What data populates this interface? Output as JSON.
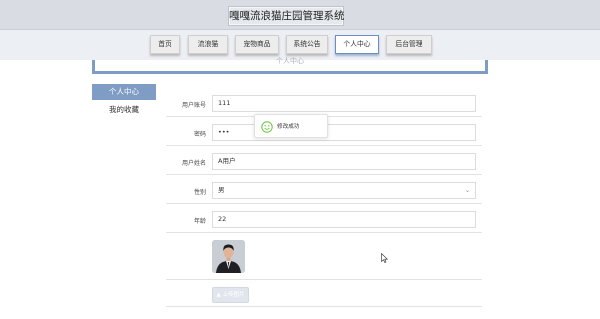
{
  "header": {
    "title": "嘎嘎流浪猫庄园管理系统"
  },
  "nav": {
    "items": [
      {
        "label": "首页"
      },
      {
        "label": "流浪猫"
      },
      {
        "label": "宠物商品"
      },
      {
        "label": "系统公告"
      },
      {
        "label": "个人中心"
      },
      {
        "label": "后台管理"
      }
    ],
    "active": "个人中心"
  },
  "panel": {
    "title": "个人中心"
  },
  "sidebar": {
    "items": [
      {
        "label": "个人中心"
      },
      {
        "label": "我的收藏"
      }
    ]
  },
  "form": {
    "account": {
      "label": "用户账号",
      "value": "111"
    },
    "password": {
      "label": "密码",
      "value": "•••"
    },
    "name": {
      "label": "用户姓名",
      "value": "A用户"
    },
    "gender": {
      "label": "性别",
      "value": "男"
    },
    "age": {
      "label": "年龄",
      "value": "22"
    },
    "upload_label": "上传图片"
  },
  "toast": {
    "text": "修改成功"
  },
  "colors": {
    "accent": "#7e9cc4",
    "toast_icon": "#67c23a"
  }
}
